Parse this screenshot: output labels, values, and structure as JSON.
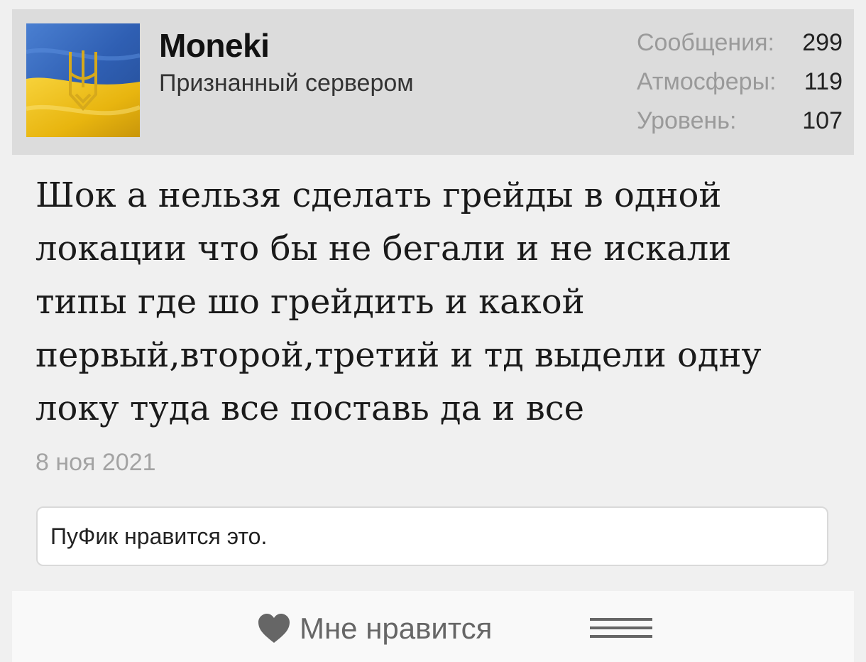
{
  "user": {
    "name": "Moneki",
    "title": "Признанный сервером",
    "avatar_icon": "ukraine-flag-trident-avatar"
  },
  "stats": [
    {
      "label": "Сообщения:",
      "value": "299"
    },
    {
      "label": "Атмосферы:",
      "value": "119"
    },
    {
      "label": "Уровень:",
      "value": "107"
    }
  ],
  "message": {
    "lines": [
      "Шок а нельзя сделать грейды в одной",
      "локации что бы не бегали и не искали",
      "типы где шо грейдить и какой",
      "первый,второй,третий и тд выдели одну",
      "локу туда все поставь да и все"
    ],
    "date": "8 ноя 2021"
  },
  "likes": {
    "text": "ПуФик нравится это."
  },
  "footer": {
    "like_label": "Мне нравится",
    "like_icon": "heart-icon",
    "menu_icon": "hamburger-menu-icon"
  },
  "colors": {
    "header_bg": "#dcdcdc",
    "page_bg": "#f0f0f0",
    "flag_blue": "#2f5fb3",
    "flag_yellow": "#f2c21b",
    "muted_text": "#9a9a9a"
  }
}
